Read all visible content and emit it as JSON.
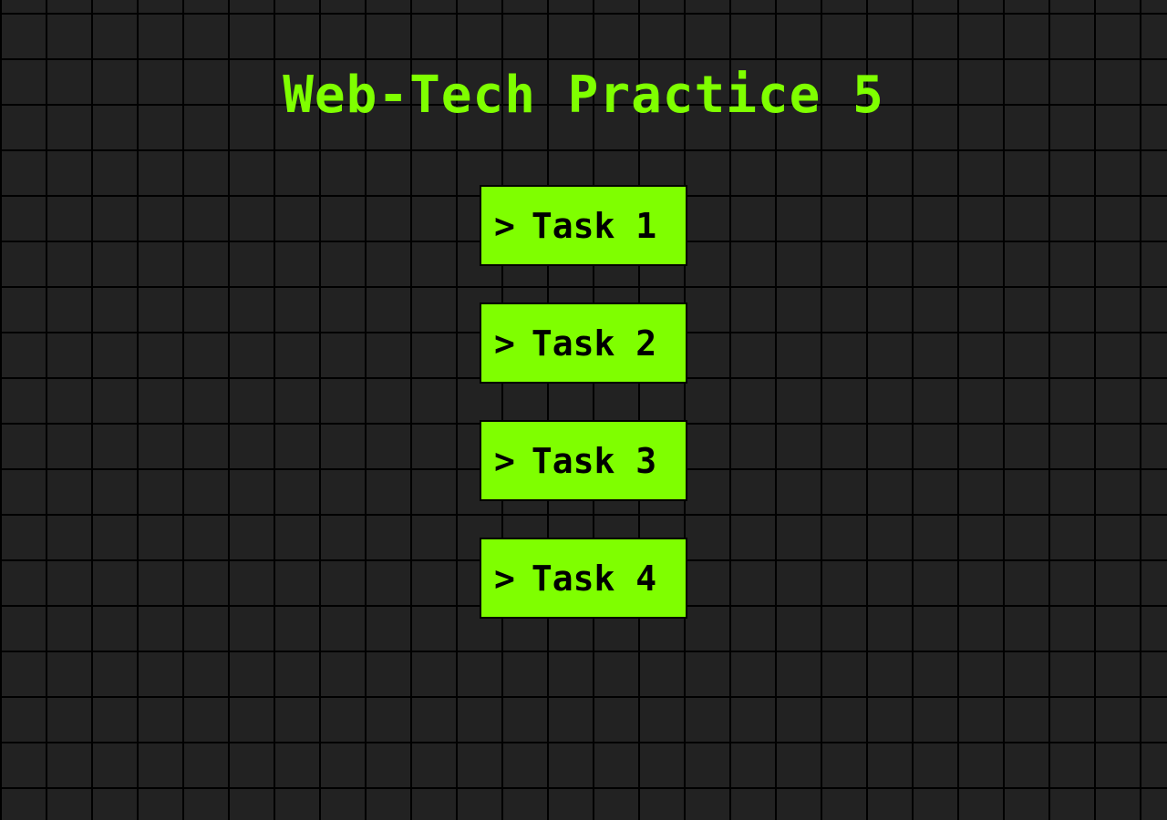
{
  "page": {
    "title": "Web-Tech Practice 5"
  },
  "tasks": [
    {
      "prompt": ">",
      "label": "Task 1"
    },
    {
      "prompt": ">",
      "label": "Task 2"
    },
    {
      "prompt": ">",
      "label": "Task 3"
    },
    {
      "prompt": ">",
      "label": "Task 4"
    }
  ],
  "colors": {
    "background": "#222222",
    "grid_lines": "#000000",
    "accent": "#7fff00",
    "button_text": "#000000"
  }
}
